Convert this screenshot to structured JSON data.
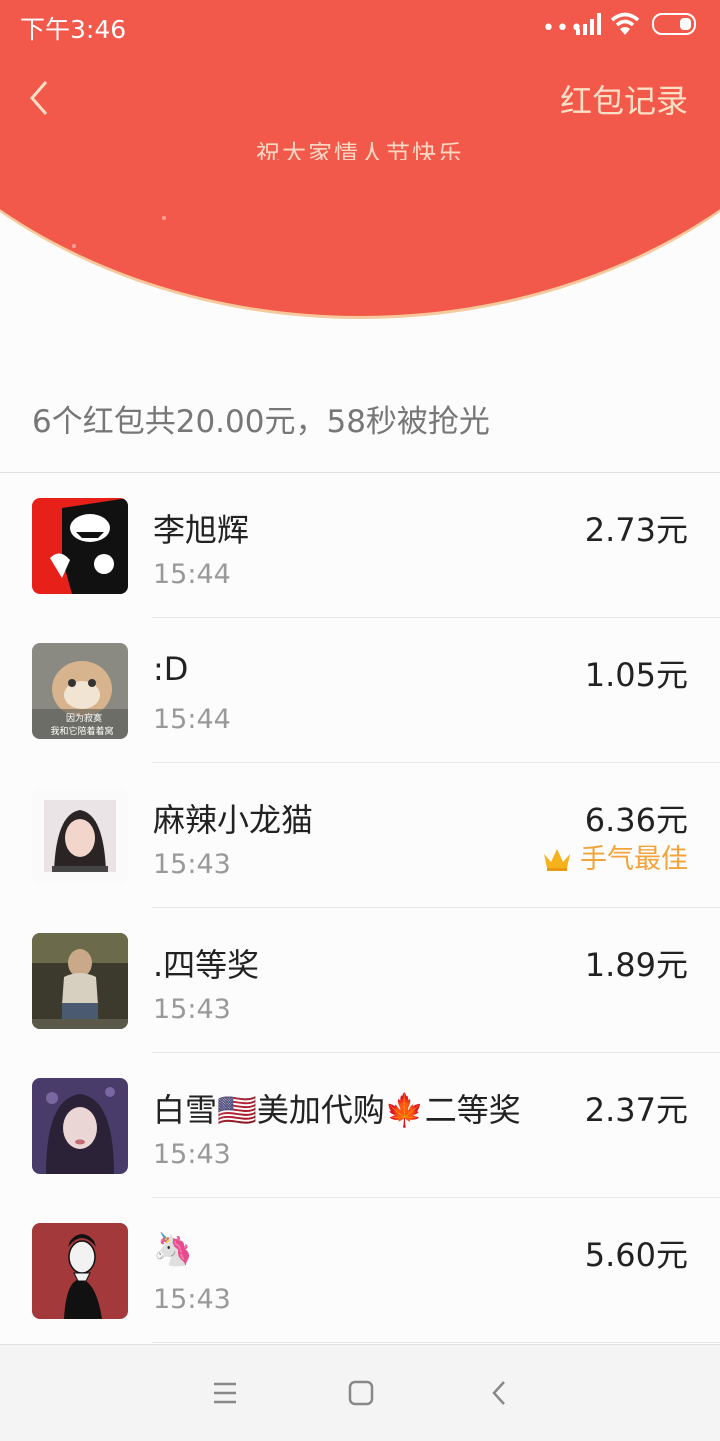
{
  "status_bar": {
    "time": "下午3:46"
  },
  "header": {
    "records_label": "红包记录",
    "blessing": "祝大家情人节快乐"
  },
  "summary": "6个红包共20.00元，58秒被抢光",
  "records": [
    {
      "name": "李旭辉",
      "time": "15:44",
      "amount": "2.73元",
      "badge": ""
    },
    {
      "name": ":D",
      "time": "15:44",
      "amount": "1.05元",
      "badge": ""
    },
    {
      "name": "麻辣小龙猫",
      "time": "15:43",
      "amount": "6.36元",
      "badge": "手气最佳"
    },
    {
      "name": ".四等奖",
      "time": "15:43",
      "amount": "1.89元",
      "badge": ""
    },
    {
      "name": "白雪🇺🇸美加代购🍁二等奖",
      "time": "15:43",
      "amount": "2.37元",
      "badge": ""
    },
    {
      "name": "🦄",
      "time": "15:43",
      "amount": "5.60元",
      "badge": ""
    }
  ],
  "avatar_overlay_text": {
    "line1": "因为寂寞",
    "line2": "我和它陪着着窝"
  },
  "icons": {
    "back": "chevron-left-icon",
    "crown": "crown-icon",
    "nav_menu": "menu-icon",
    "nav_home": "home-icon",
    "nav_back": "back-icon"
  },
  "colors": {
    "header_red": "#f3594b",
    "records_link": "#fbe0c5",
    "best_luck": "#f2a33a"
  }
}
